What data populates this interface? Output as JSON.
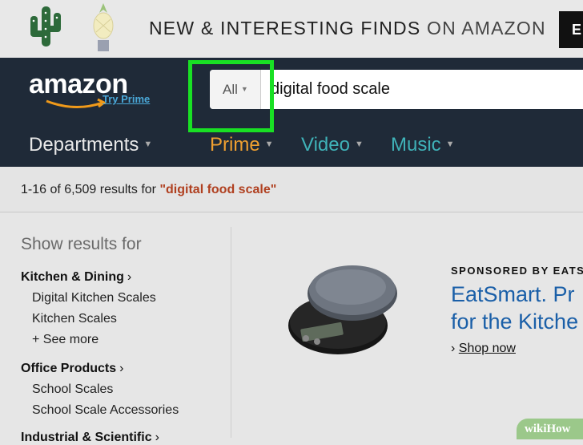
{
  "banner": {
    "promo_bold": "NEW & INTERESTING FINDS",
    "promo_thin": "ON AMAZON",
    "button_label": "E"
  },
  "header": {
    "logo_text": "amazon",
    "try_prime": "Try Prime",
    "search": {
      "category": "All",
      "query": "digital food scale"
    },
    "nav": {
      "departments": "Departments",
      "prime": "Prime",
      "video": "Video",
      "music": "Music"
    }
  },
  "results": {
    "count_text": "1-16 of 6,509 results for ",
    "query_text": "\"digital food scale\""
  },
  "sidebar": {
    "heading": "Show results for",
    "categories": [
      {
        "label": "Kitchen & Dining",
        "items": [
          "Digital Kitchen Scales",
          "Kitchen Scales"
        ],
        "see_more": "+ See more"
      },
      {
        "label": "Office Products",
        "items": [
          "School Scales",
          "School Scale Accessories"
        ]
      },
      {
        "label": "Industrial & Scientific"
      }
    ]
  },
  "sponsored": {
    "label": "SPONSORED BY EATS",
    "title_line1": "EatSmart. Pr",
    "title_line2": "for the Kitche",
    "shop_now": "Shop now"
  },
  "watermark": "wikiHow",
  "colors": {
    "header_bg": "#1f2a38",
    "highlight_box": "#19e024",
    "prime_orange": "#f0a030",
    "nav_teal": "#3fb2b8",
    "link_blue": "#1a5fa8",
    "query_red": "#b04020"
  }
}
